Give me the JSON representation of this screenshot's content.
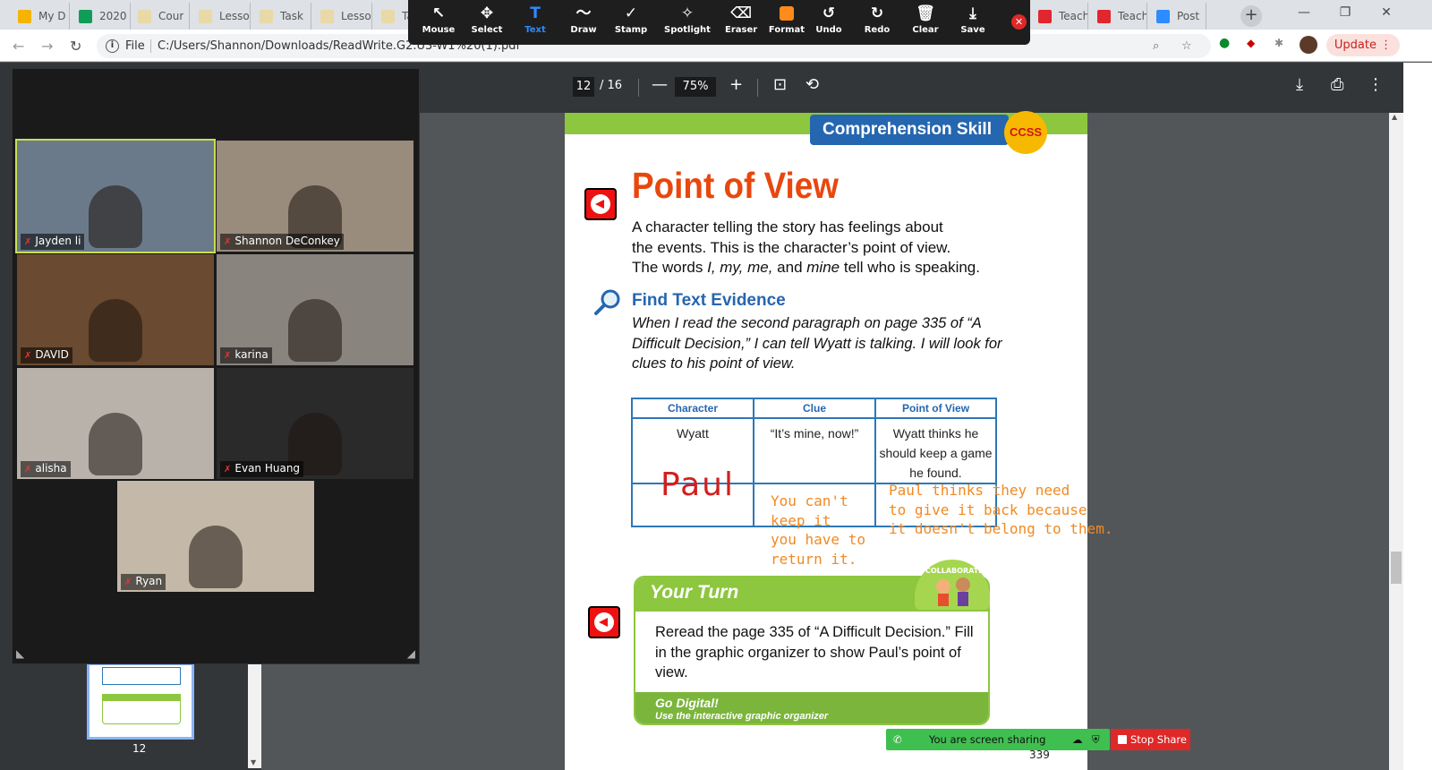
{
  "browser": {
    "tabs": [
      {
        "label": "My D",
        "color": "#f5b400"
      },
      {
        "label": "2020",
        "color": "#0f9d58"
      },
      {
        "label": "Cour",
        "color": "#e8d9a6"
      },
      {
        "label": "Lesso",
        "color": "#e8d9a6"
      },
      {
        "label": "Task",
        "color": "#e8d9a6"
      },
      {
        "label": "Lesso",
        "color": "#e8d9a6"
      },
      {
        "label": "Ta",
        "color": "#e8d9a6"
      }
    ],
    "right_tabs": [
      {
        "label": "Teach",
        "color": "#e0262e"
      },
      {
        "label": "Teach",
        "color": "#e0262e"
      },
      {
        "label": "Post",
        "color": "#2d8cff"
      }
    ],
    "new_tab": "+",
    "file_label": "File",
    "url": "C:/Users/Shannon/Downloads/ReadWrite.G2.U3-W1%20(1).pdf",
    "update_label": "Update"
  },
  "annotate_toolbar": {
    "tools": [
      {
        "label": "Mouse",
        "icon": "↖"
      },
      {
        "label": "Select",
        "icon": "✥"
      },
      {
        "label": "Text",
        "icon": "T"
      },
      {
        "label": "Draw",
        "icon": "〜"
      },
      {
        "label": "Stamp",
        "icon": "✓"
      },
      {
        "label": "Spotlight",
        "icon": "✧"
      },
      {
        "label": "Eraser",
        "icon": "⌫"
      },
      {
        "label": "Format",
        "icon": "■"
      },
      {
        "label": "Undo",
        "icon": "↺"
      },
      {
        "label": "Redo",
        "icon": "↻"
      },
      {
        "label": "Clear",
        "icon": "🗑"
      },
      {
        "label": "Save",
        "icon": "⤓"
      }
    ],
    "active": "Text",
    "format_color": "#ff8c1a",
    "close_icon": "✕"
  },
  "pdf_toolbar": {
    "page_current": "12",
    "page_total": "/ 16",
    "zoom": "75%",
    "zoom_out": "—",
    "zoom_in": "+"
  },
  "thumbnail": {
    "page_number": "12"
  },
  "document": {
    "banner": "Comprehension Skill",
    "badge": "CCSS",
    "title": "Point of View",
    "intro_1": "A character telling the story has feelings about",
    "intro_2": "the events. This is the character’s point of view.",
    "intro_3a": "The words ",
    "intro_3b": "I, my, me,",
    "intro_3c": " and ",
    "intro_3d": "mine",
    "intro_3e": " tell who is speaking.",
    "find_heading": "Find Text Evidence",
    "evidence": "When I read the second paragraph on page 335 of “A Difficult Decision,” I can tell Wyatt is talking. I will look for clues to his point of view.",
    "table": {
      "headers": [
        "Character",
        "Clue",
        "Point of View"
      ],
      "row1": [
        "Wyatt",
        "“It’s mine, now!”",
        "Wyatt thinks he should keep a game he found."
      ]
    },
    "handwritten_paul": "Paul",
    "typed_clue": "You can't\nkeep it\nyou have to\nreturn it.",
    "typed_pov": "Paul thinks they need\nto give it back because\nit doesn't belong to them.",
    "your_turn": {
      "title": "Your Turn",
      "collaborate": "COLLABORATE",
      "body": "Reread the page 335 of “A Difficult Decision.” Fill in the graphic organizer to show Paul’s point of view.",
      "go_digital": "Go Digital!",
      "go_digital_sub": "Use the interactive graphic organizer"
    },
    "page_number": "339"
  },
  "zoom": {
    "participants": [
      {
        "name": "Jayden li",
        "bg": "#6b7a8a",
        "active": true
      },
      {
        "name": "Shannon DeConkey",
        "bg": "#9a8c7c",
        "active": false
      },
      {
        "name": "DAVID",
        "bg": "#6a4a30",
        "active": false
      },
      {
        "name": "karina",
        "bg": "#8a847e",
        "active": false
      },
      {
        "name": "alisha",
        "bg": "#b8b2aa",
        "active": false
      },
      {
        "name": "Evan Huang",
        "bg": "#2a2a2a",
        "active": false
      },
      {
        "name": "Ryan",
        "bg": "#c4b8a8",
        "active": false
      }
    ],
    "sharing_text": "You are screen sharing",
    "stop_share": "Stop Share"
  }
}
